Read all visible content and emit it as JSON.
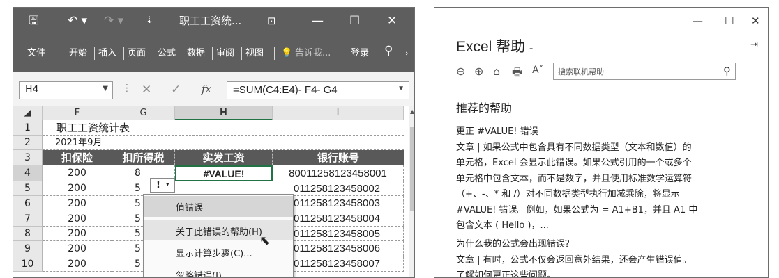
{
  "excel": {
    "title": "职工工资统...",
    "tabs": [
      "文件",
      "开始",
      "插入",
      "页面",
      "公式",
      "数据",
      "审阅",
      "视图"
    ],
    "tell_me": "告诉我...",
    "login": "登录",
    "namebox": "H4",
    "formula": "=SUM(C4:E4)- F4- G4",
    "columns": [
      "F",
      "G",
      "H",
      "I"
    ],
    "rows": [
      "1",
      "2",
      "3",
      "4",
      "5",
      "6",
      "7",
      "8",
      "9",
      "10"
    ],
    "sheet_title": "职工工资统计表",
    "date": "2021年9月",
    "headers": [
      "扣保险",
      "扣所得税",
      "实发工资",
      "银行账号"
    ],
    "insurance": [
      "200",
      "200",
      "200",
      "200",
      "200",
      "200",
      "200"
    ],
    "tax_first": "8",
    "tax_partial": [
      "5",
      "5",
      "5",
      "5",
      "5",
      "5"
    ],
    "h4_value": "#VALUE!",
    "accounts": [
      "80011258123458001",
      "011258123458002",
      "011258123458003",
      "011258123458004",
      "011258123458005",
      "011258123458006",
      "011258123458007"
    ],
    "smart_tag": "!",
    "menu": {
      "header": "值错误",
      "items": [
        "关于此错误的帮助(H)",
        "显示计算步骤(C)...",
        "忽略错误(I)"
      ]
    }
  },
  "help": {
    "title": "Excel 帮助",
    "title_dash": "-",
    "search_placeholder": "搜索联机帮助",
    "section1": "推荐的帮助",
    "link1": "更正 #VALUE! 错误",
    "para1": [
      "文章 | 如果公式中包含具有不同数据类型（文本和数值）的",
      "单元格，Excel 会显示此错误。如果公式引用的一个或多个",
      "单元格中包含文本，而不是数字，并且使用标准数学运算符",
      "（+、-、* 和 /）对不同数据类型执行加减乘除，将显示",
      "#VALUE! 错误。例如，如果公式为 = A1+B1，并且 A1 中",
      "包含文本 ( Hello )，..."
    ],
    "link2": "为什么我的公式会出现错误？",
    "para2": [
      "文章 | 有时，公式不仅会返回意外结果，还会产生错误值。",
      "了解如何更正这些问题。"
    ]
  }
}
